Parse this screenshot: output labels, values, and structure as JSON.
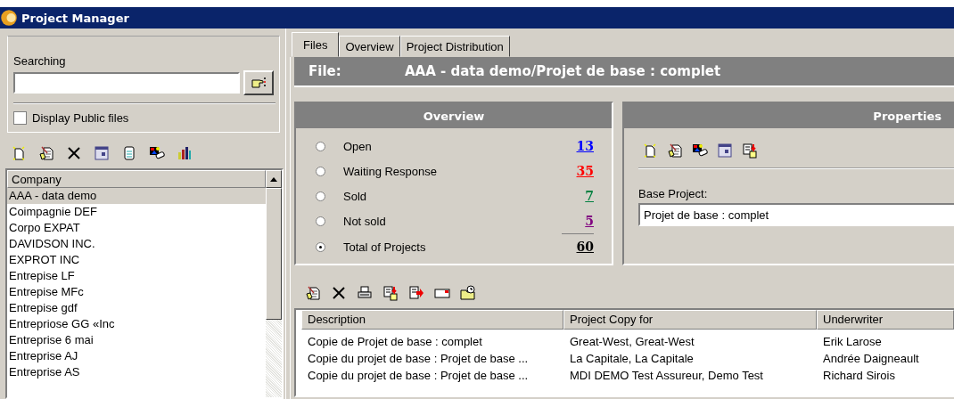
{
  "window": {
    "title": "Project Manager"
  },
  "search": {
    "label": "Searching"
  },
  "public_files": {
    "label": "Display Public files",
    "checked": false
  },
  "company_list": {
    "header": "Company",
    "items": [
      {
        "name": "AAA - data demo",
        "selected": true
      },
      {
        "name": "Coimpagnie DEF",
        "selected": false
      },
      {
        "name": "Corpo EXPAT",
        "selected": false
      },
      {
        "name": "DAVIDSON INC.",
        "selected": false
      },
      {
        "name": "EXPROT INC",
        "selected": false
      },
      {
        "name": "Entrepise LF",
        "selected": false
      },
      {
        "name": "Entrepise MFc",
        "selected": false
      },
      {
        "name": "Entrepise gdf",
        "selected": false
      },
      {
        "name": "Entrepriose GG «Inc",
        "selected": false
      },
      {
        "name": "Entreprise 6 mai",
        "selected": false
      },
      {
        "name": "Entreprise AJ",
        "selected": false
      },
      {
        "name": "Entreprise AS",
        "selected": false
      }
    ]
  },
  "tabs": [
    {
      "label": "Files",
      "selected": true
    },
    {
      "label": "Overview",
      "selected": false
    },
    {
      "label": "Project Distribution",
      "selected": false
    }
  ],
  "file_bar": {
    "label": "File:",
    "value": "AAA - data demo/Projet de base : complet"
  },
  "overview": {
    "title": "Overview",
    "statuses": [
      {
        "label": "Open",
        "count": "13",
        "color": "#0000ff",
        "selected": false
      },
      {
        "label": "Waiting Response",
        "count": "35",
        "color": "#ff0000",
        "selected": false
      },
      {
        "label": "Sold",
        "count": "7",
        "color": "#008040",
        "selected": false
      },
      {
        "label": "Not sold",
        "count": "5",
        "color": "#800080",
        "selected": false
      },
      {
        "label": "Total of Projects",
        "count": "60",
        "color": "#000000",
        "selected": true
      }
    ]
  },
  "properties": {
    "title": "Properties",
    "base_project_label": "Base Project:",
    "base_project_value": "Projet de base : complet"
  },
  "table": {
    "columns": [
      "Description",
      "Project Copy for",
      "Underwriter"
    ],
    "rows": [
      [
        "Copie de Projet de base : complet",
        "Great-West, Great-West",
        "Erik Larose"
      ],
      [
        "Copie du projet de base : Projet de base ...",
        "La Capitale, La Capitale",
        "Andrée Daigneault"
      ],
      [
        "Copie du projet de base : Projet de base ...",
        "MDI DEMO Test Assureur, Demo Test",
        "Richard Sirois"
      ]
    ]
  }
}
